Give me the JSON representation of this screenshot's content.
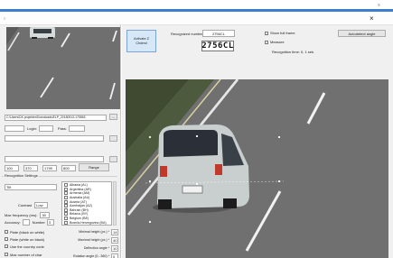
{
  "window": {
    "close_glyph": "×",
    "title_left": "≡"
  },
  "left": {
    "path_value": "C:\\Users\\DK projekter\\Downloads\\ELP_20180913-175565",
    "browse_glyph": "...",
    "login_label": "Login:",
    "pass_label": "Pass:",
    "crop_values": [
      "100",
      "370",
      "1799",
      "800"
    ],
    "range_button": "Range",
    "section_title": "Recognition Settings",
    "tilt_value": "Tilt",
    "contrast_label": "Contrast",
    "contrast_value": "Low",
    "freq_label": "Max frequency (ms):",
    "freq_value": "30",
    "accuracy_label": "Accuracy:",
    "number_label": "Number",
    "number_value": "3",
    "options": [
      "Plate (black on white)",
      "Plate (white on black)",
      "Use the country code",
      "Max number of char"
    ],
    "countries": [
      "Albania (AL)",
      "Argentina (AR)",
      "Armenia (AM)",
      "Australia (AU)",
      "Austria (AT)",
      "Azerbaijan (AZ)",
      "Bahrain (BH)",
      "Belarus (BY)",
      "Belgium (BE)",
      "Bosnia-Herzegovina (BA)"
    ],
    "min_height_label": "Minimal height (px.) *",
    "min_height_value": "14",
    "max_height_label": "Maximal height (px.) *",
    "max_height_value": "40",
    "deflect_label": "Deflection angle *",
    "deflect_value": "10",
    "rotation_label": "Rotation angle (0...360) *",
    "rotation_value": "0"
  },
  "right": {
    "activate_label_1": "Activate Z",
    "activate_label_2": "Chdmd",
    "recognized_label": "Recognized number:",
    "recognized_value": "2756CL",
    "plate_text": "2756CL",
    "show_full_frame": "Show full frame",
    "measure": "Measure",
    "autorecognize_button": "Autodetect angle",
    "recognition_time": "Recognition time: 0, 1 sek."
  },
  "colors": {
    "accent": "#3b7fd4",
    "panel": "#f0f0f0",
    "road": "#6f706f",
    "car": "#c9cfcf"
  },
  "icons": {
    "window_close": "close-icon",
    "browse": "ellipsis-icon"
  }
}
